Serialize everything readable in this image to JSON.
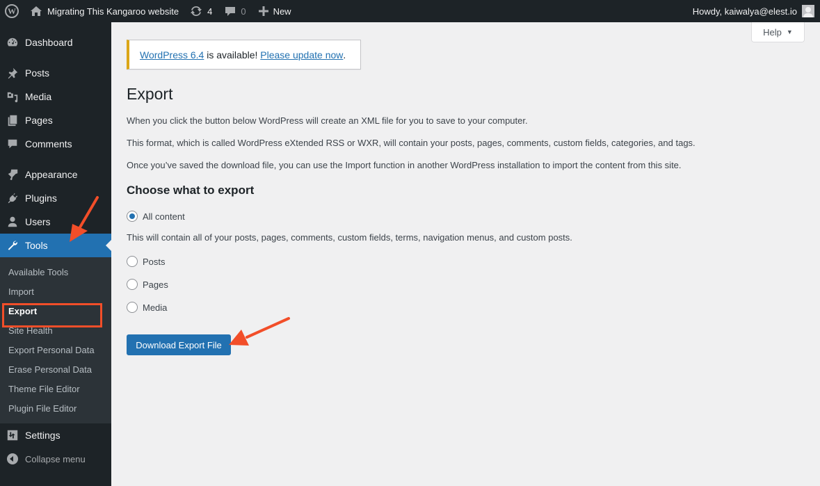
{
  "adminbar": {
    "wp_logo_label": "W",
    "site_name": "Migrating This Kangaroo website",
    "updates_count": "4",
    "comments_count": "0",
    "new_label": "New",
    "howdy": "Howdy, kaiwalya@elest.io"
  },
  "sidebar": {
    "items": [
      {
        "label": "Dashboard",
        "icon": "dashboard-icon"
      },
      {
        "label": "Posts",
        "icon": "pin-icon"
      },
      {
        "label": "Media",
        "icon": "media-icon"
      },
      {
        "label": "Pages",
        "icon": "pages-icon"
      },
      {
        "label": "Comments",
        "icon": "comment-icon"
      },
      {
        "label": "Appearance",
        "icon": "paintbrush-icon"
      },
      {
        "label": "Plugins",
        "icon": "plugin-icon"
      },
      {
        "label": "Users",
        "icon": "user-icon"
      },
      {
        "label": "Tools",
        "icon": "wrench-icon",
        "current": true
      },
      {
        "label": "Settings",
        "icon": "settings-icon"
      }
    ],
    "tools_submenu": [
      {
        "label": "Available Tools"
      },
      {
        "label": "Import"
      },
      {
        "label": "Export",
        "current": true
      },
      {
        "label": "Site Health"
      },
      {
        "label": "Export Personal Data"
      },
      {
        "label": "Erase Personal Data"
      },
      {
        "label": "Theme File Editor"
      },
      {
        "label": "Plugin File Editor"
      }
    ],
    "collapse_label": "Collapse menu"
  },
  "help": {
    "label": "Help",
    "arrow": "▼"
  },
  "notice": {
    "link1": "WordPress 6.4",
    "middle": " is available! ",
    "link2": "Please update now",
    "end": "."
  },
  "page": {
    "title": "Export",
    "paragraphs": [
      "When you click the button below WordPress will create an XML file for you to save to your computer.",
      "This format, which is called WordPress eXtended RSS or WXR, will contain your posts, pages, comments, custom fields, categories, and tags.",
      "Once you’ve saved the download file, you can use the Import function in another WordPress installation to import the content from this site."
    ],
    "section_title": "Choose what to export",
    "options": [
      {
        "label": "All content",
        "checked": true
      },
      {
        "label": "Posts",
        "checked": false
      },
      {
        "label": "Pages",
        "checked": false
      },
      {
        "label": "Media",
        "checked": false
      }
    ],
    "all_content_description": "This will contain all of your posts, pages, comments, custom fields, terms, navigation menus, and custom posts.",
    "download_button": "Download Export File"
  },
  "colors": {
    "adminbar_bg": "#1d2327",
    "accent": "#2271b1",
    "notice_warning": "#dba617",
    "annotation": "#f24e29"
  }
}
